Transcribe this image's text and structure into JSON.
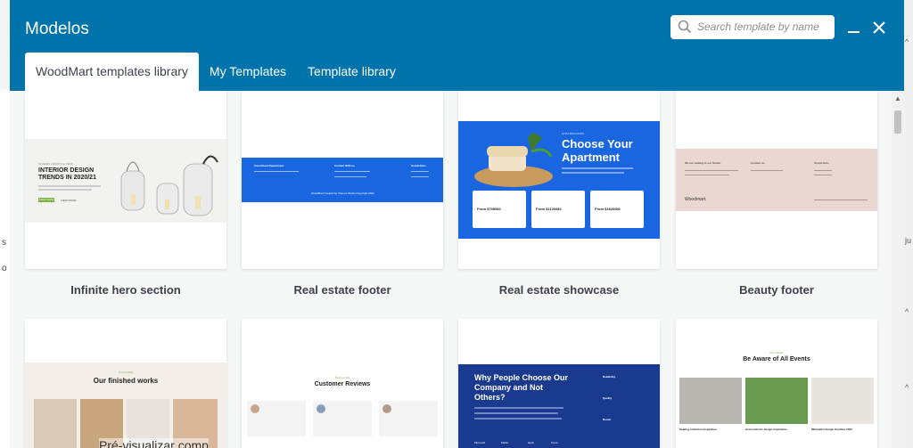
{
  "modal": {
    "title": "Modelos",
    "search_placeholder": "Search template by name",
    "tabs": [
      {
        "label": "WoodMart templates library",
        "active": true
      },
      {
        "label": "My Templates",
        "active": false
      },
      {
        "label": "Template library",
        "active": false
      }
    ]
  },
  "cards": [
    {
      "title": "Infinite hero section",
      "thumb": {
        "eyebrow": "MODERN LIFESTYLE TEXT",
        "heading": "INTERIOR DESIGN TRENDS IN 2020/21",
        "button": "SHOP NOW",
        "link": "VIEW MORE"
      }
    },
    {
      "title": "Real estate footer",
      "thumb": {
        "col1": "Investment Department",
        "col2": "Contact With us",
        "col3": "Social links",
        "bottom": "WoodMart Created by Xtemos Studio Copyright 2021"
      }
    },
    {
      "title": "Real estate showcase",
      "thumb": {
        "eyebrow": "ELIZA BUILDINGS",
        "heading": "Choose Your Apartment",
        "prices": [
          "From $795/M2",
          "From $1120/M2",
          "From $1820/M2"
        ]
      }
    },
    {
      "title": "Beauty footer",
      "thumb": {
        "col1": "We are waiting in our Studio",
        "col2": "Contact us",
        "col3": "Social links",
        "brand": "Woodmart."
      }
    },
    {
      "title": "",
      "thumb": {
        "eyebrow": "Our portfolio",
        "heading": "Our finished works"
      }
    },
    {
      "title": "",
      "thumb": {
        "eyebrow": "Testimonials",
        "heading": "Customer Reviews"
      }
    },
    {
      "title": "",
      "thumb": {
        "heading": "Why People Choose Our Company and Not Others?",
        "features": [
          "Reliability",
          "Quality",
          "Result"
        ],
        "logos": [
          "Microsoft",
          "Mattis",
          "slack",
          "Pyres"
        ]
      }
    },
    {
      "title": "",
      "thumb": {
        "eyebrow": "Our articles",
        "heading": "Be Aware of All Events",
        "captions": [
          "Seating collection inspiration",
          "Green interior design inspiration",
          "Minimalist design furniture 2020"
        ]
      }
    }
  ],
  "background": {
    "overlay_text": "Pré-visualizar comp"
  },
  "colors": {
    "header": "#0073aa",
    "accent_blue": "#1a66e0",
    "navy": "#1a3a8f"
  }
}
